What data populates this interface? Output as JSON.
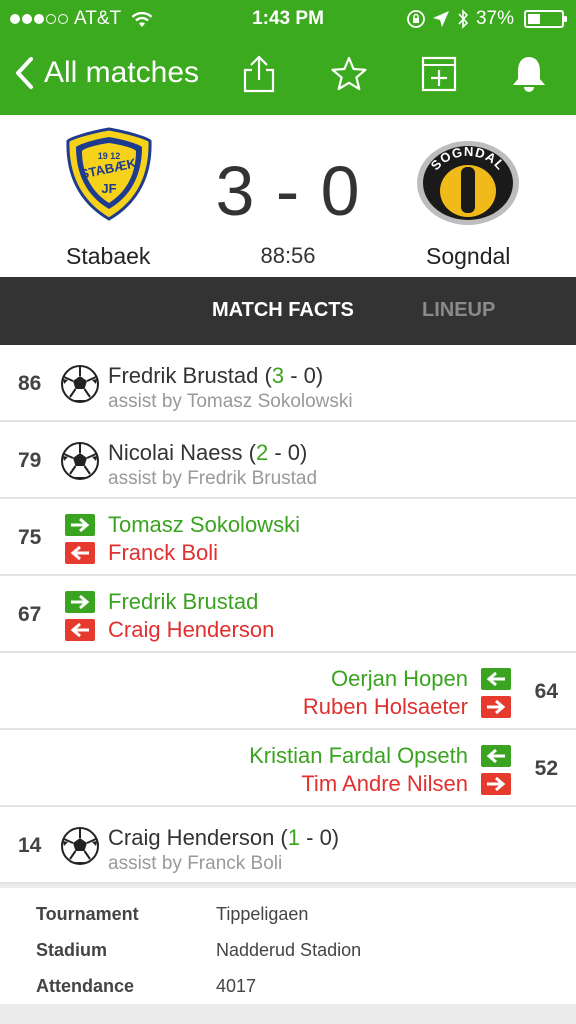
{
  "status_bar": {
    "carrier": "AT&T",
    "time": "1:43 PM",
    "battery": "37%",
    "battery_level": 0.37
  },
  "nav": {
    "back_label": "All matches"
  },
  "match": {
    "home_team": "Stabaek",
    "away_team": "Sogndal",
    "score": "3 - 0",
    "clock": "88:56",
    "home_logo_text": {
      "year": "19 12",
      "name": "STABÆK",
      "initials": "JF"
    },
    "away_logo_text": {
      "name": "SOGNDAL"
    }
  },
  "tabs": [
    {
      "label": "MATCH FACTS",
      "active": true
    },
    {
      "label": "LINEUP",
      "active": false
    }
  ],
  "events": [
    {
      "minute": "86",
      "type": "goal",
      "side": "home",
      "player": "Fredrik Brustad",
      "score_open": " (",
      "score_home": "3",
      "score_rest": " - 0)",
      "assist": "assist by Tomasz Sokolowski"
    },
    {
      "minute": "79",
      "type": "goal",
      "side": "home",
      "player": "Nicolai Naess",
      "score_open": " (",
      "score_home": "2",
      "score_rest": " - 0)",
      "assist": "assist by Fredrik Brustad"
    },
    {
      "minute": "75",
      "type": "sub",
      "side": "home",
      "in": "Tomasz Sokolowski",
      "out": "Franck Boli"
    },
    {
      "minute": "67",
      "type": "sub",
      "side": "home",
      "in": "Fredrik Brustad",
      "out": "Craig Henderson"
    },
    {
      "minute": "64",
      "type": "sub",
      "side": "away",
      "in": "Oerjan Hopen",
      "out": "Ruben Holsaeter"
    },
    {
      "minute": "52",
      "type": "sub",
      "side": "away",
      "in": "Kristian Fardal Opseth",
      "out": "Tim Andre Nilsen"
    },
    {
      "minute": "14",
      "type": "goal",
      "side": "home",
      "player": "Craig Henderson",
      "score_open": " (",
      "score_home": "1",
      "score_rest": " - 0)",
      "assist": "assist by Franck Boli"
    }
  ],
  "info": [
    {
      "key": "Tournament",
      "value": "Tippeligaen"
    },
    {
      "key": "Stadium",
      "value": "Nadderud Stadion"
    },
    {
      "key": "Attendance",
      "value": "4017"
    }
  ],
  "colors": {
    "brand_green": "#3caa1e",
    "sub_in": "#3aa31f",
    "sub_out": "#e03030",
    "tab_bar": "#333333"
  }
}
